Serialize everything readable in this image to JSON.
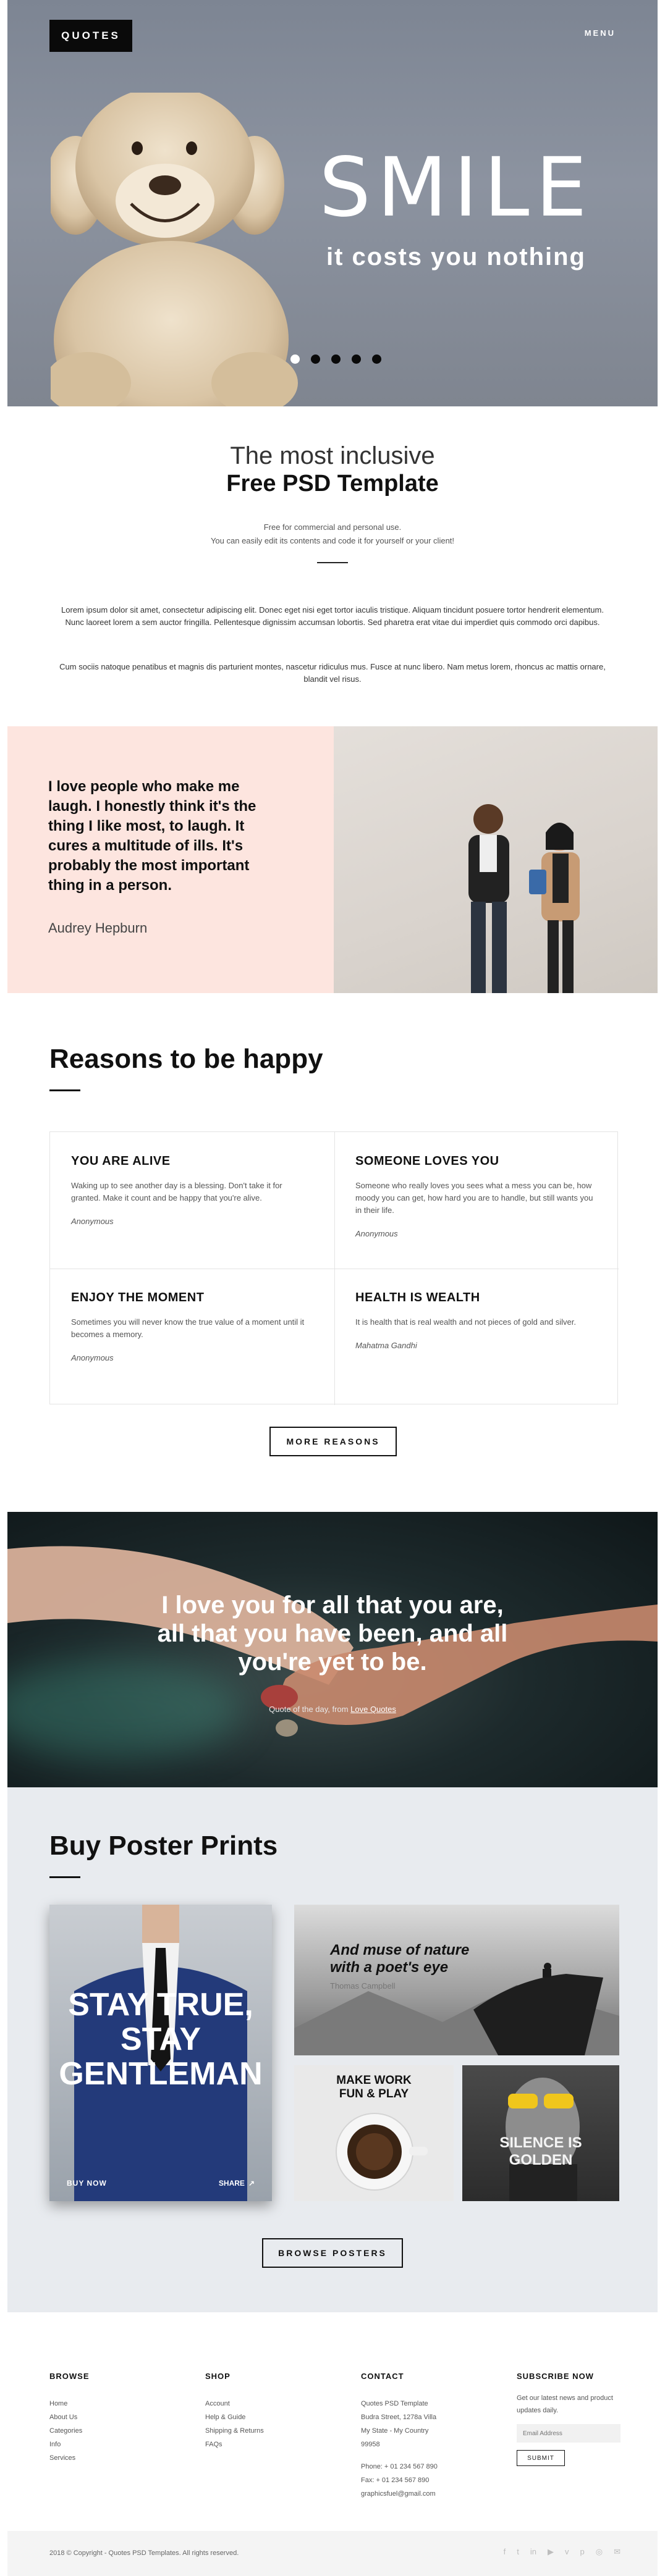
{
  "header": {
    "logo": "QUOTES",
    "menu": "MENU"
  },
  "hero": {
    "title": "SMILE",
    "subtitle": "it costs you nothing",
    "active_slide": 1,
    "slide_count": 5
  },
  "intro": {
    "light": "The most inclusive",
    "bold": "Free PSD Template",
    "small1": "Free for commercial and personal use.",
    "small2": "You can easily edit its contents and code it for yourself or your client!",
    "para1": "Lorem ipsum dolor sit amet, consectetur adipiscing elit. Donec eget nisi eget tortor iaculis tristique. Aliquam tincidunt posuere tortor hendrerit elementum. Nunc laoreet lorem a sem auctor fringilla. Pellentesque dignissim accumsan lobortis. Sed pharetra erat vitae dui imperdiet quis commodo orci dapibus.",
    "para2": "Cum sociis natoque penatibus et magnis dis parturient montes, nascetur ridiculus mus. Fusce at nunc libero. Nam metus lorem, rhoncus ac mattis ornare, blandit vel risus."
  },
  "quote_banner": {
    "text": "I love people who make me laugh. I honestly think it's the thing I like most, to laugh. It cures a multitude of ills. It's probably the most important thing in a person.",
    "author": "Audrey Hepburn"
  },
  "reasons": {
    "title": "Reasons to be happy",
    "items": [
      {
        "title": "YOU ARE ALIVE",
        "text": "Waking up to see another day is a blessing. Don't take it for granted. Make it count and be happy that you're alive.",
        "by": "Anonymous"
      },
      {
        "title": "SOMEONE LOVES YOU",
        "text": "Someone who really loves you sees what a mess you can be, how moody you can get, how hard you are to handle, but still wants you in their life.",
        "by": "Anonymous"
      },
      {
        "title": "ENJOY THE MOMENT",
        "text": "Sometimes you will never know the true value of a moment until it becomes a memory.",
        "by": "Anonymous"
      },
      {
        "title": "HEALTH IS WEALTH",
        "text": "It is health that is real wealth and not pieces of gold and silver.",
        "by": "Mahatma Gandhi"
      }
    ],
    "button": "MORE REASONS"
  },
  "dark_quote": {
    "text": "I love you for all that you are, all that you have been, and all you're yet to be.",
    "source_prefix": "Quote of the day, from ",
    "source_link": "Love Quotes"
  },
  "posters": {
    "title": "Buy Poster Prints",
    "big": {
      "text": "STAY TRUE, STAY GENTLEMAN",
      "buy": "BUY NOW",
      "share": "SHARE"
    },
    "nature": {
      "line1": "And muse of nature",
      "line2": "with a poet's eye",
      "by": "Thomas Campbell"
    },
    "coffee": {
      "line1": "MAKE WORK",
      "line2": "FUN & PLAY"
    },
    "silence": {
      "line1": "SILENCE IS",
      "line2": "GOLDEN"
    },
    "button": "BROWSE POSTERS"
  },
  "footer": {
    "browse": {
      "title": "BROWSE",
      "items": [
        "Home",
        "About Us",
        "Categories",
        "Info",
        "Services"
      ]
    },
    "shop": {
      "title": "SHOP",
      "items": [
        "Account",
        "Help & Guide",
        "Shipping & Returns",
        "FAQs"
      ]
    },
    "contact": {
      "title": "CONTACT",
      "lines": [
        "Quotes PSD Template",
        "Budra Street, 1278a Villa",
        "My State - My Country",
        "99958"
      ],
      "phone": "Phone: + 01 234 567 890",
      "fax": "Fax: + 01 234 567 890",
      "email": "graphicsfuel@gmail.com"
    },
    "subscribe": {
      "title": "SUBSCRIBE NOW",
      "text": "Get our latest news and product updates daily.",
      "placeholder": "Email Address",
      "button": "SUBMIT"
    },
    "copyright": "2018 © Copyright - Quotes PSD Templates. All rights reserved.",
    "social": [
      "facebook-icon",
      "twitter-icon",
      "linkedin-icon",
      "youtube-icon",
      "vimeo-icon",
      "pinterest-icon",
      "instagram-icon",
      "email-icon"
    ]
  }
}
